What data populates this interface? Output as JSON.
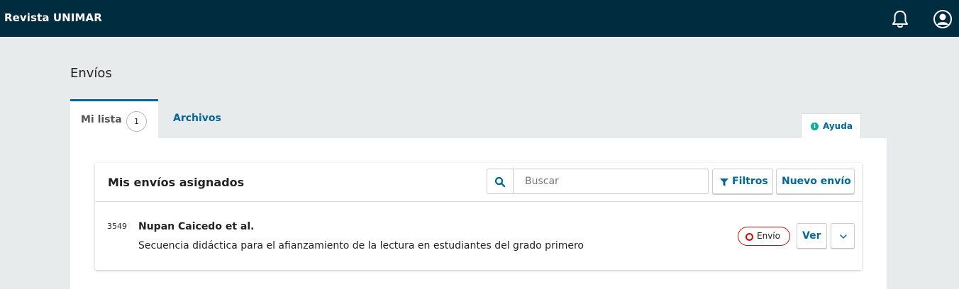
{
  "header": {
    "site_title": "Revista UNIMAR",
    "notifications_icon": "bell-icon",
    "user_icon": "user-circle-icon",
    "background": "#002c40"
  },
  "page": {
    "title": "Envíos"
  },
  "tabs": [
    {
      "label": "Mi lista",
      "count": "1",
      "active": true
    },
    {
      "label": "Archivos",
      "active": false
    }
  ],
  "help": {
    "label": "Ayuda",
    "icon": "info-icon"
  },
  "list": {
    "title": "Mis envíos asignados",
    "search": {
      "placeholder": "Buscar",
      "value": "",
      "icon": "search-icon"
    },
    "filters_label": "Filtros",
    "filters_icon": "filter-icon",
    "new_label": "Nuevo envío"
  },
  "submissions": [
    {
      "id": "3549",
      "authors": "Nupan Caicedo et al.",
      "title": "Secuencia didáctica para el afianzamiento de la lectura en estudiantes del grado primero",
      "stage": "Envío",
      "stage_color": "#d00a0a",
      "view_label": "Ver",
      "expand_icon": "chevron-down-icon"
    }
  ],
  "colors": {
    "primary": "#006798",
    "success": "#00b28e"
  }
}
